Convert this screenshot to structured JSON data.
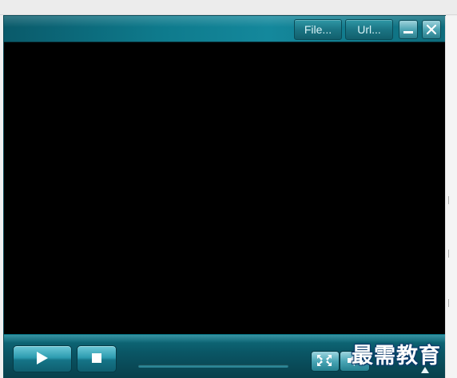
{
  "titlebar": {
    "file_label": "File...",
    "url_label": "Url..."
  },
  "controls": {
    "play_icon": "play-icon",
    "stop_icon": "stop-icon",
    "fullscreen_icon": "fullscreen-icon",
    "volume_icon": "speaker-icon"
  },
  "watermark": {
    "text": "最需教育"
  },
  "colors": {
    "accent": "#0e7a8c",
    "video_background": "#000000"
  }
}
